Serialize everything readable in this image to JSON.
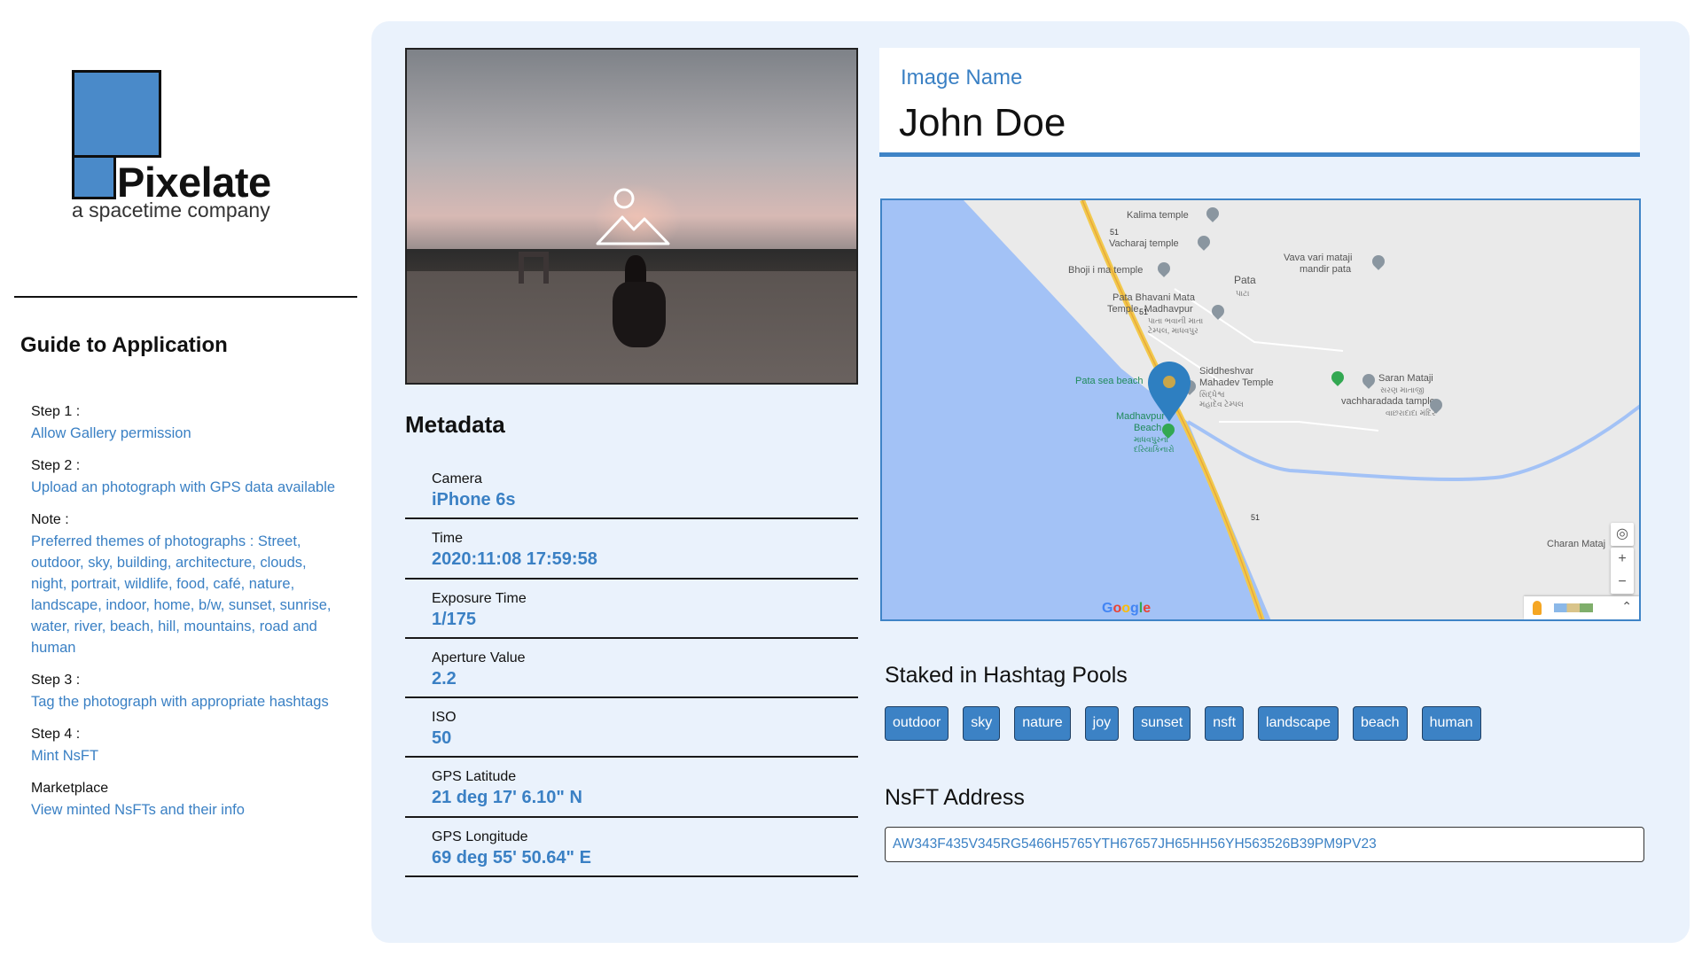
{
  "brand": {
    "name": "Pixelate",
    "tagline": "a spacetime company",
    "colors": {
      "accent": "#3c82c5",
      "panel_bg": "#eaf2fc",
      "logo_blue": "#4a8ac9"
    }
  },
  "guide": {
    "title": "Guide to Application",
    "steps": [
      {
        "title": "Step 1 :",
        "text": "Allow Gallery permission"
      },
      {
        "title": "Step 2 :",
        "text": "Upload an photograph with GPS data available"
      },
      {
        "title": "Note :",
        "text": "Preferred themes of photographs : Street, outdoor, sky, building, architecture, clouds, night, portrait, wildlife, food, café, nature, landscape, indoor, home, b/w, sunset, sunrise, water, river, beach, hill, mountains, road and human"
      },
      {
        "title": "Step 3 :",
        "text": "Tag the photograph with appropriate hashtags"
      },
      {
        "title": "Step 4 :",
        "text": "Mint NsFT"
      },
      {
        "title": "Marketplace",
        "text": "View minted NsFTs and their info"
      }
    ]
  },
  "photo": {
    "icon": "image-placeholder-icon"
  },
  "metadata": {
    "title": "Metadata",
    "fields": [
      {
        "label": "Camera",
        "value": "iPhone 6s"
      },
      {
        "label": "Time",
        "value": "2020:11:08 17:59:58"
      },
      {
        "label": "Exposure Time",
        "value": "1/175"
      },
      {
        "label": "Aperture Value",
        "value": "2.2"
      },
      {
        "label": "ISO",
        "value": "50"
      },
      {
        "label": "GPS Latitude",
        "value": "21 deg 17' 6.10\" N"
      },
      {
        "label": "GPS Longitude",
        "value": "69 deg 55' 50.64\" E"
      }
    ]
  },
  "image_name": {
    "label": "Image Name",
    "value": "John Doe"
  },
  "map": {
    "labels": {
      "kalima": "Kalima temple",
      "vacharaj": "Vacharaj temple",
      "bhoji": "Bhoji i ma temple",
      "vava": "Vava vari mataji",
      "vava2": "mandir pata",
      "pata": "Pata",
      "pata_gu": "પાટા",
      "bhavani": "Pata Bhavani Mata",
      "bhavani2": "Temple, Madhavpur",
      "bhavani_gu": "પાતા ભવાની માતા",
      "bhavani_gu2": "ટેમ્પલ, માધવપુર",
      "sidd": "Siddheshvar",
      "sidd2": "Mahadev Temple",
      "sidd_gu": "સિદ્ધેશ્વ",
      "sidd_gu2": "મહાદેવ ટેમ્પલ",
      "patasea": "Pata sea beach",
      "saran": "Saran Mataji",
      "saran_gu": "સરણ માતાજી",
      "vachh": "vachharadada tample",
      "vachh_gu": "વાછરાદાદા મંદિર",
      "madh": "Madhavpur",
      "madh2": "Beach",
      "madh_gu": "માધવપુરનો",
      "madh_gu2": "દરિયાકિનારો",
      "charan": "Charan Mataj",
      "road51a": "51",
      "road51b": "51",
      "road51c": "51",
      "google": "Google",
      "zoom_in": "+",
      "zoom_out": "−",
      "expand": "⌃"
    }
  },
  "staked": {
    "title": "Staked in Hashtag Pools",
    "tags": [
      "outdoor",
      "sky",
      "nature",
      "joy",
      "sunset",
      "nsft",
      "landscape",
      "beach",
      "human"
    ]
  },
  "nsft": {
    "title": "NsFT Address",
    "address": "AW343F435V345RG5466H5765YTH67657JH65HH56YH563526B39PM9PV23"
  }
}
